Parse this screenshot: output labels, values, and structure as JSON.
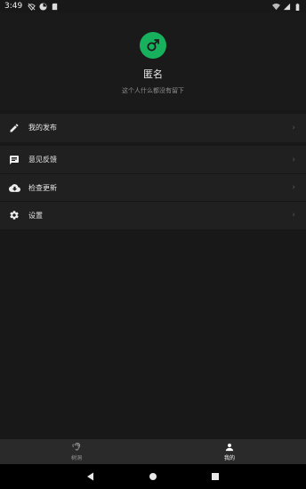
{
  "status_bar": {
    "time": "3:49"
  },
  "profile": {
    "name": "匿名",
    "bio": "这个人什么都没有留下",
    "avatar_icon": "male-symbol-icon",
    "avatar_color": "#17b15d"
  },
  "menu": {
    "items": [
      {
        "label": "我的发布",
        "icon": "pencil-icon"
      },
      {
        "label": "意见反馈",
        "icon": "chat-icon"
      },
      {
        "label": "检查更新",
        "icon": "cloud-download-icon"
      },
      {
        "label": "设置",
        "icon": "gear-icon"
      }
    ],
    "chevron": "›"
  },
  "bottom_nav": {
    "tabs": [
      {
        "label": "树洞",
        "icon": "ear-icon",
        "active": false
      },
      {
        "label": "我的",
        "icon": "person-icon",
        "active": true
      }
    ]
  }
}
